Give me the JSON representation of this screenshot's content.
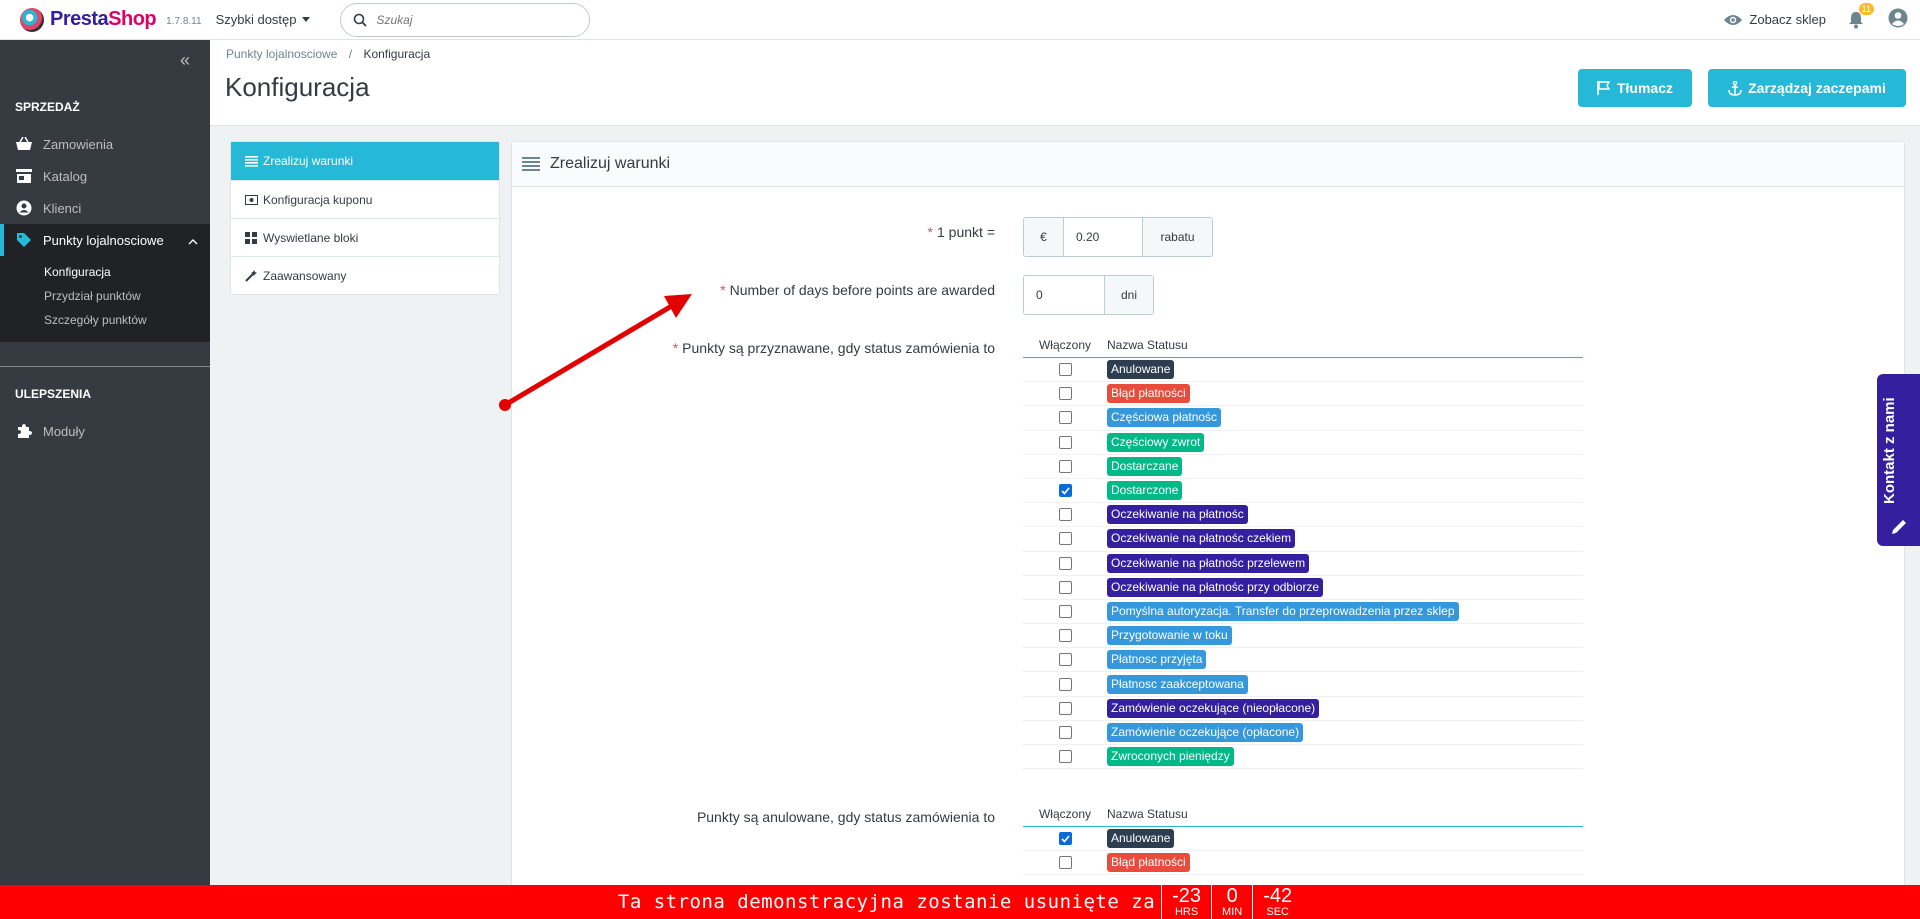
{
  "header": {
    "brand_presta": "Presta",
    "brand_shop": "Shop",
    "version": "1.7.8.11",
    "quick_access": "Szybki dostęp",
    "search_placeholder": "Szukaj",
    "view_shop": "Zobacz sklep",
    "notifications_count": "11"
  },
  "sidebar": {
    "section_sales": "SPRZEDAŻ",
    "items": [
      {
        "label": "Zamowienia"
      },
      {
        "label": "Katalog"
      },
      {
        "label": "Klienci"
      },
      {
        "label": "Punkty lojalnosciowe"
      }
    ],
    "subitems": [
      {
        "label": "Konfiguracja"
      },
      {
        "label": "Przydział punktów"
      },
      {
        "label": "Szczegóły punktów"
      }
    ],
    "section_improve": "ULEPSZENIA",
    "modules": "Moduły"
  },
  "page": {
    "breadcrumb_parent": "Punkty lojalnosciowe",
    "breadcrumb_separator": "/",
    "breadcrumb_current": "Konfiguracja",
    "title": "Konfiguracja",
    "btn_translate": "Tłumacz",
    "btn_hooks": "Zarządzaj zaczepami"
  },
  "tabs": [
    {
      "label": "Zrealizuj warunki"
    },
    {
      "label": "Konfiguracja kuponu"
    },
    {
      "label": "Wyswietlane bloki"
    },
    {
      "label": "Zaawansowany"
    }
  ],
  "panel": {
    "title": "Zrealizuj warunki",
    "required_mark": "*",
    "point_label": "1 punkt =",
    "point_currency": "€",
    "point_value": "0.20",
    "point_suffix": "rabatu",
    "days_label": "Number of days before points are awarded",
    "days_value": "0",
    "days_suffix": "dni",
    "awarded_label": "Punkty są przyznawane, gdy status zamówienia to",
    "cancelled_label": "Punkty są anulowane, gdy status zamówienia to",
    "col_enabled": "Włączony",
    "col_status": "Nazwa Statusu"
  },
  "statuses": [
    {
      "name": "Anulowane",
      "color": "#2c3e50",
      "checked": false
    },
    {
      "name": "Błąd płatności",
      "color": "#e74c3c",
      "checked": false
    },
    {
      "name": "Częściowa płatnośc",
      "color": "#3498db",
      "checked": false
    },
    {
      "name": "Częściowy zwrot",
      "color": "#01b887",
      "checked": false
    },
    {
      "name": "Dostarczane",
      "color": "#01b887",
      "checked": false
    },
    {
      "name": "Dostarczone",
      "color": "#01b887",
      "checked": true
    },
    {
      "name": "Oczekiwanie na płatnośc",
      "color": "#34209e",
      "checked": false
    },
    {
      "name": "Oczekiwanie na płatnośc czekiem",
      "color": "#34209e",
      "checked": false
    },
    {
      "name": "Oczekiwanie na płatnośc przelewem",
      "color": "#34209e",
      "checked": false
    },
    {
      "name": "Oczekiwanie na płatnośc przy odbiorze",
      "color": "#34209e",
      "checked": false
    },
    {
      "name": "Pomyślna autoryzacja. Transfer do przeprowadzenia przez sklep",
      "color": "#3498db",
      "checked": false
    },
    {
      "name": "Przygotowanie w toku",
      "color": "#3498db",
      "checked": false
    },
    {
      "name": "Płatnosc przyjęta",
      "color": "#3498db",
      "checked": false
    },
    {
      "name": "Płatnosc zaakceptowana",
      "color": "#3498db",
      "checked": false
    },
    {
      "name": "Zamówienie oczekujące (nieopłacone)",
      "color": "#34209e",
      "checked": false
    },
    {
      "name": "Zamówienie oczekujące (opłacone)",
      "color": "#3498db",
      "checked": false
    },
    {
      "name": "Zwroconych pieniędzy",
      "color": "#01b887",
      "checked": false
    }
  ],
  "cancel_statuses": [
    {
      "name": "Anulowane",
      "color": "#2c3e50",
      "checked": true
    },
    {
      "name": "Błąd płatności",
      "color": "#e74c3c",
      "checked": false
    }
  ],
  "contact": "Kontakt z nami",
  "demo": {
    "message": "Ta strona demonstracyjna zostanie usunięte za",
    "hrs": "-23",
    "hrs_label": "HRS",
    "min": "0",
    "min_label": "MIN",
    "sec": "-42",
    "sec_label": "SEC"
  },
  "colors": {
    "accent": "#25b9d7",
    "sidebar": "#363a41",
    "annotation_arrow": "#e30000"
  }
}
